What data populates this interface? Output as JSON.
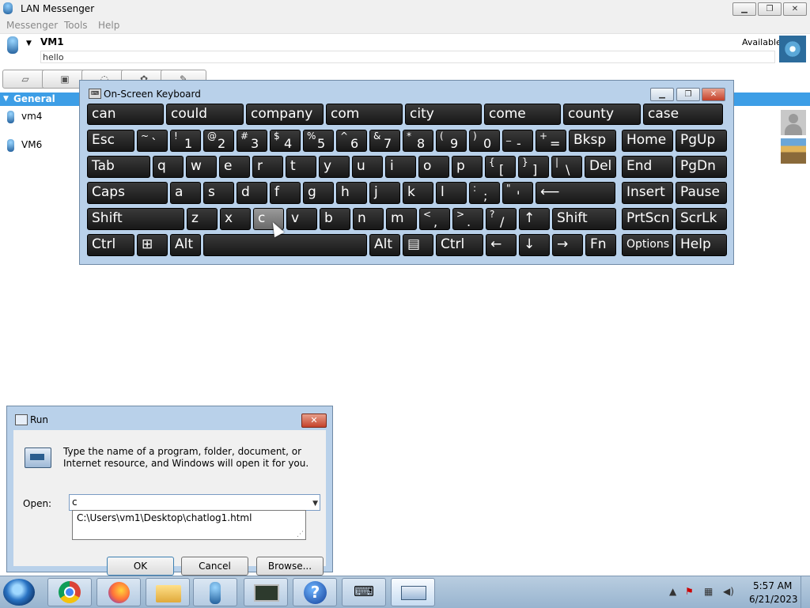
{
  "lan": {
    "title": "LAN Messenger",
    "menu": [
      "Messenger",
      "Tools",
      "Help"
    ],
    "user": {
      "name": "VM1",
      "note": "hello",
      "status": "Available"
    },
    "group": "General",
    "contacts": [
      "vm4",
      "VM6"
    ]
  },
  "osk": {
    "title": "On-Screen Keyboard",
    "predictions": [
      "can",
      "could",
      "company",
      "com",
      "city",
      "come",
      "county",
      "case"
    ],
    "row1": [
      {
        "label": "Esc"
      },
      {
        "shift": "~",
        "main": "`"
      },
      {
        "shift": "!",
        "main": "1"
      },
      {
        "shift": "@",
        "main": "2"
      },
      {
        "shift": "#",
        "main": "3"
      },
      {
        "shift": "$",
        "main": "4"
      },
      {
        "shift": "%",
        "main": "5"
      },
      {
        "shift": "^",
        "main": "6"
      },
      {
        "shift": "&",
        "main": "7"
      },
      {
        "shift": "*",
        "main": "8"
      },
      {
        "shift": "(",
        "main": "9"
      },
      {
        "shift": ")",
        "main": "0"
      },
      {
        "shift": "_",
        "main": "-"
      },
      {
        "shift": "+",
        "main": "="
      },
      {
        "label": "Bksp"
      }
    ],
    "row2": [
      {
        "label": "Tab"
      },
      {
        "label": "q"
      },
      {
        "label": "w"
      },
      {
        "label": "e"
      },
      {
        "label": "r"
      },
      {
        "label": "t"
      },
      {
        "label": "y"
      },
      {
        "label": "u"
      },
      {
        "label": "i"
      },
      {
        "label": "o"
      },
      {
        "label": "p"
      },
      {
        "shift": "{",
        "main": "["
      },
      {
        "shift": "}",
        "main": "]"
      },
      {
        "shift": "|",
        "main": "\\"
      },
      {
        "label": "Del"
      }
    ],
    "row3": [
      {
        "label": "Caps"
      },
      {
        "label": "a"
      },
      {
        "label": "s"
      },
      {
        "label": "d"
      },
      {
        "label": "f"
      },
      {
        "label": "g"
      },
      {
        "label": "h"
      },
      {
        "label": "j"
      },
      {
        "label": "k"
      },
      {
        "label": "l"
      },
      {
        "shift": ":",
        "main": ";"
      },
      {
        "shift": "\"",
        "main": "'"
      },
      {
        "label": "⟵"
      }
    ],
    "row4": [
      {
        "label": "Shift"
      },
      {
        "label": "z"
      },
      {
        "label": "x"
      },
      {
        "label": "c"
      },
      {
        "label": "v"
      },
      {
        "label": "b"
      },
      {
        "label": "n"
      },
      {
        "label": "m"
      },
      {
        "shift": "<",
        "main": ","
      },
      {
        "shift": ">",
        "main": "."
      },
      {
        "shift": "?",
        "main": "/"
      },
      {
        "label": "↑"
      },
      {
        "label": "Shift"
      }
    ],
    "row5": [
      {
        "label": "Ctrl"
      },
      {
        "label": "⊞"
      },
      {
        "label": "Alt"
      },
      {
        "label": ""
      },
      {
        "label": "Alt"
      },
      {
        "label": "▤"
      },
      {
        "label": "Ctrl"
      },
      {
        "label": "←"
      },
      {
        "label": "↓"
      },
      {
        "label": "→"
      },
      {
        "label": "Fn"
      }
    ],
    "nav": [
      [
        "Home",
        "PgUp"
      ],
      [
        "End",
        "PgDn"
      ],
      [
        "Insert",
        "Pause"
      ],
      [
        "PrtScn",
        "ScrLk"
      ],
      [
        "Options",
        "Help"
      ]
    ]
  },
  "run": {
    "title": "Run",
    "prompt": "Type the name of a program, folder, document, or Internet resource, and Windows will open it for you.",
    "open_label": "Open:",
    "input_value": "c",
    "suggestion": "C:\\Users\\vm1\\Desktop\\chatlog1.html",
    "ok": "OK",
    "cancel": "Cancel",
    "browse": "Browse..."
  },
  "taskbar": {
    "time": "5:57 AM",
    "date": "6/21/2023"
  }
}
